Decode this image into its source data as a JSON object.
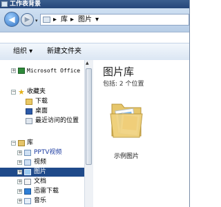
{
  "window": {
    "title": "工作表背景"
  },
  "address": {
    "crumbs": [
      "库",
      "图片"
    ],
    "sep": "▸",
    "dropdown": "▾",
    "history_dropdown": "▾"
  },
  "nav": {
    "back": "◀",
    "forward": "▶"
  },
  "toolbar": {
    "organize": "组织 ▾",
    "new_folder": "新建文件夹"
  },
  "scrollbar": {
    "up": "▲"
  },
  "sidebar": {
    "items": [
      {
        "label": "Microsoft Office",
        "expander": "+",
        "icon": "office-icon"
      },
      {
        "label": "收藏夹",
        "expander": "−",
        "icon": "star-icon"
      },
      {
        "label": "下载",
        "icon": "download-folder-icon"
      },
      {
        "label": "桌面",
        "icon": "desktop-icon"
      },
      {
        "label": "最近访问的位置",
        "icon": "recent-places-icon"
      },
      {
        "label": "库",
        "expander": "−",
        "icon": "library-icon"
      },
      {
        "label": "PPTV视频",
        "expander": "+",
        "icon": "pptv-icon"
      },
      {
        "label": "视频",
        "expander": "+",
        "icon": "video-library-icon"
      },
      {
        "label": "图片",
        "expander": "+",
        "icon": "pictures-library-icon",
        "selected": true
      },
      {
        "label": "文档",
        "expander": "+",
        "icon": "documents-library-icon"
      },
      {
        "label": "迅雷下载",
        "expander": "+",
        "icon": "thunder-icon"
      },
      {
        "label": "音乐",
        "expander": "+",
        "icon": "music-library-icon"
      }
    ]
  },
  "main": {
    "title": "图片库",
    "subtitle": "包括: 2 个位置",
    "folder_label": "示例图片"
  }
}
